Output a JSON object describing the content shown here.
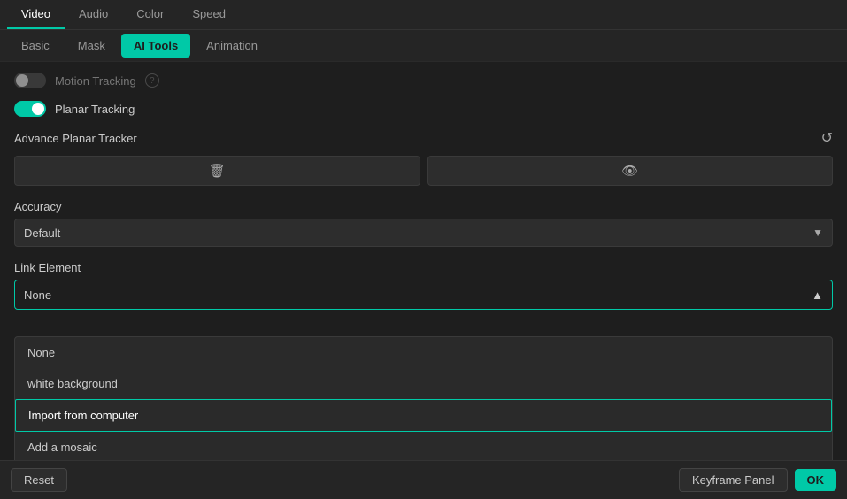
{
  "top_tabs": {
    "tabs": [
      {
        "id": "video",
        "label": "Video",
        "active": true
      },
      {
        "id": "audio",
        "label": "Audio",
        "active": false
      },
      {
        "id": "color",
        "label": "Color",
        "active": false
      },
      {
        "id": "speed",
        "label": "Speed",
        "active": false
      }
    ]
  },
  "sub_tabs": {
    "tabs": [
      {
        "id": "basic",
        "label": "Basic",
        "active": false
      },
      {
        "id": "mask",
        "label": "Mask",
        "active": false
      },
      {
        "id": "ai_tools",
        "label": "AI Tools",
        "active": true
      },
      {
        "id": "animation",
        "label": "Animation",
        "active": false
      }
    ]
  },
  "motion_tracking": {
    "label": "Motion Tracking",
    "enabled": false,
    "info": "?"
  },
  "planar_tracking": {
    "label": "Planar Tracking",
    "enabled": true
  },
  "advance_planar_tracker": {
    "title": "Advance Planar Tracker",
    "delete_icon": "🗑",
    "eye_icon": "👁",
    "reset_icon": "↺"
  },
  "accuracy": {
    "label": "Accuracy",
    "value": "Default",
    "arrow": "▼"
  },
  "link_element": {
    "label": "Link Element",
    "value": "None",
    "arrow": "▲"
  },
  "dropdown_items": [
    {
      "id": "none",
      "label": "None",
      "highlighted": false
    },
    {
      "id": "white_background",
      "label": "white background",
      "highlighted": false
    },
    {
      "id": "import_from_computer",
      "label": "Import from computer",
      "highlighted": true
    },
    {
      "id": "add_a_mosaic",
      "label": "Add a mosaic",
      "highlighted": false
    }
  ],
  "bottom_bar": {
    "reset_label": "Reset",
    "keyframe_panel_label": "Keyframe Panel",
    "ok_label": "OK"
  }
}
